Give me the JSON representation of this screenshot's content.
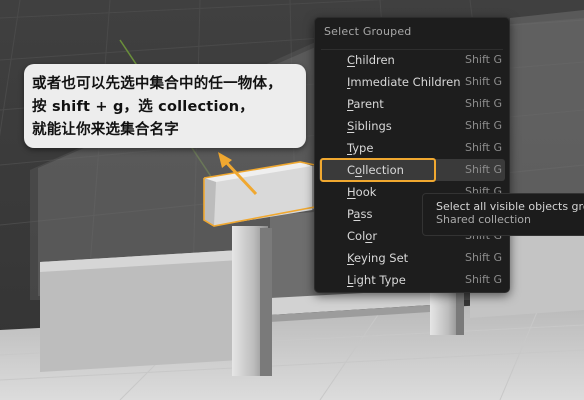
{
  "annotation": {
    "line1": "或者也可以先选中集合中的任一物体，",
    "line2": "按 shift + g，选 collection，",
    "line3": "就能让你来选集合名字"
  },
  "menu": {
    "title": "Select Grouped",
    "items": [
      {
        "label": "Children",
        "mnemonic_index": 0,
        "shortcut": "Shift G"
      },
      {
        "label": "Immediate Children",
        "mnemonic_index": 0,
        "shortcut": "Shift G"
      },
      {
        "label": "Parent",
        "mnemonic_index": 0,
        "shortcut": "Shift G"
      },
      {
        "label": "Siblings",
        "mnemonic_index": 0,
        "shortcut": "Shift G"
      },
      {
        "label": "Type",
        "mnemonic_index": 0,
        "shortcut": "Shift G"
      },
      {
        "label": "Collection",
        "mnemonic_index": 1,
        "shortcut": "Shift G",
        "highlighted": true
      },
      {
        "label": "Hook",
        "mnemonic_index": 0,
        "shortcut": "Shift G"
      },
      {
        "label": "Pass",
        "mnemonic_index": 1,
        "shortcut": "Shift G"
      },
      {
        "label": "Color",
        "mnemonic_index": 3,
        "shortcut": "Shift G"
      },
      {
        "label": "Keying Set",
        "mnemonic_index": 0,
        "shortcut": "Shift G"
      },
      {
        "label": "Light Type",
        "mnemonic_index": 0,
        "shortcut": "Shift G"
      }
    ]
  },
  "tooltip": {
    "line1": "Select all visible objects grou",
    "line2": "Shared collection"
  },
  "colors": {
    "highlight_outline": "#f0a830",
    "arrow": "#f0a830",
    "selected_object_outline": "#f0a830",
    "menu_background": "#1d1d1d",
    "callout_background": "#ededed"
  }
}
